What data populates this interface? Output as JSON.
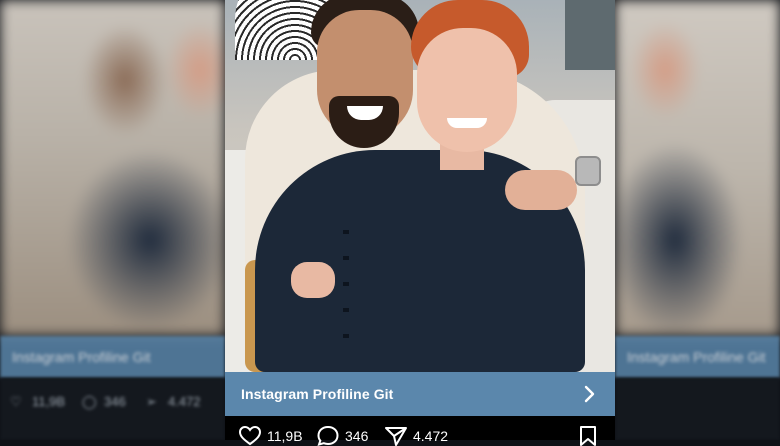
{
  "post": {
    "cta_label": "Instagram Profiline Git",
    "likes": "11,9B",
    "comments": "346",
    "shares": "4.472"
  },
  "blurred_left": {
    "banner_label": "Instagram Profiline Git",
    "likes": "11,9B",
    "comments": "346",
    "shares": "4.472"
  },
  "blurred_right": {
    "banner_label": "Instagram Profiline Git"
  },
  "icons": {
    "like": "heart-icon",
    "comment": "comment-bubble-icon",
    "share": "paper-plane-icon",
    "save": "bookmark-icon",
    "cta": "chevron-right-icon"
  },
  "colors": {
    "cta_background": "#5b87ac",
    "background": "#000000"
  }
}
